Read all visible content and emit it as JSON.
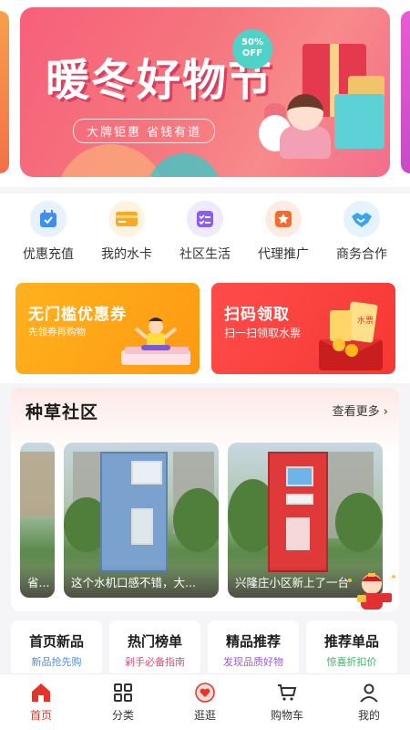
{
  "banner": {
    "title": "暖冬好物节",
    "subtitle": "大牌钜惠 省钱有道",
    "badge_line1": "50%",
    "badge_line2": "OFF"
  },
  "quick_nav": [
    {
      "label": "优惠充值",
      "icon": "calendar-check-icon",
      "color": "#3e8ef5"
    },
    {
      "label": "我的水卡",
      "icon": "card-icon",
      "color": "#f7a824"
    },
    {
      "label": "社区生活",
      "icon": "list-check-icon",
      "color": "#8a5cf6"
    },
    {
      "label": "代理推广",
      "icon": "star-badge-icon",
      "color": "#f76a2c"
    },
    {
      "label": "商务合作",
      "icon": "handshake-icon",
      "color": "#3aa6f0"
    }
  ],
  "promos": {
    "coupon": {
      "title": "无门槛优惠券",
      "subtitle": "先领券再购物"
    },
    "scan": {
      "title": "扫码领取",
      "subtitle": "扫一扫领取水票",
      "ticket_text": "水票"
    }
  },
  "community": {
    "title": "种草社区",
    "more": "查看更多",
    "posts": [
      {
        "caption": "省..."
      },
      {
        "caption": "这个水机口感不错，大..."
      },
      {
        "caption": "兴隆庄小区新上了一台"
      }
    ]
  },
  "categories": [
    {
      "title": "首页新品",
      "subtitle": "新品抢先购",
      "color": "#4a8fe0"
    },
    {
      "title": "热门榜单",
      "subtitle": "剁手必备指南",
      "color": "#e84a7a"
    },
    {
      "title": "精品推荐",
      "subtitle": "发现品质好物",
      "color": "#9a5cd8"
    },
    {
      "title": "推荐单品",
      "subtitle": "惊喜折扣价",
      "color": "#3bb56a"
    }
  ],
  "tabbar": [
    {
      "label": "首页",
      "icon": "home-icon",
      "active": true
    },
    {
      "label": "分类",
      "icon": "grid-icon",
      "active": false
    },
    {
      "label": "逛逛",
      "icon": "heart-bubble-icon",
      "active": false
    },
    {
      "label": "购物车",
      "icon": "cart-icon",
      "active": false
    },
    {
      "label": "我的",
      "icon": "person-icon",
      "active": false
    }
  ],
  "colors": {
    "accent": "#e5352b",
    "coupon_bg": "#ffa81a",
    "scan_bg": "#f7423e"
  }
}
